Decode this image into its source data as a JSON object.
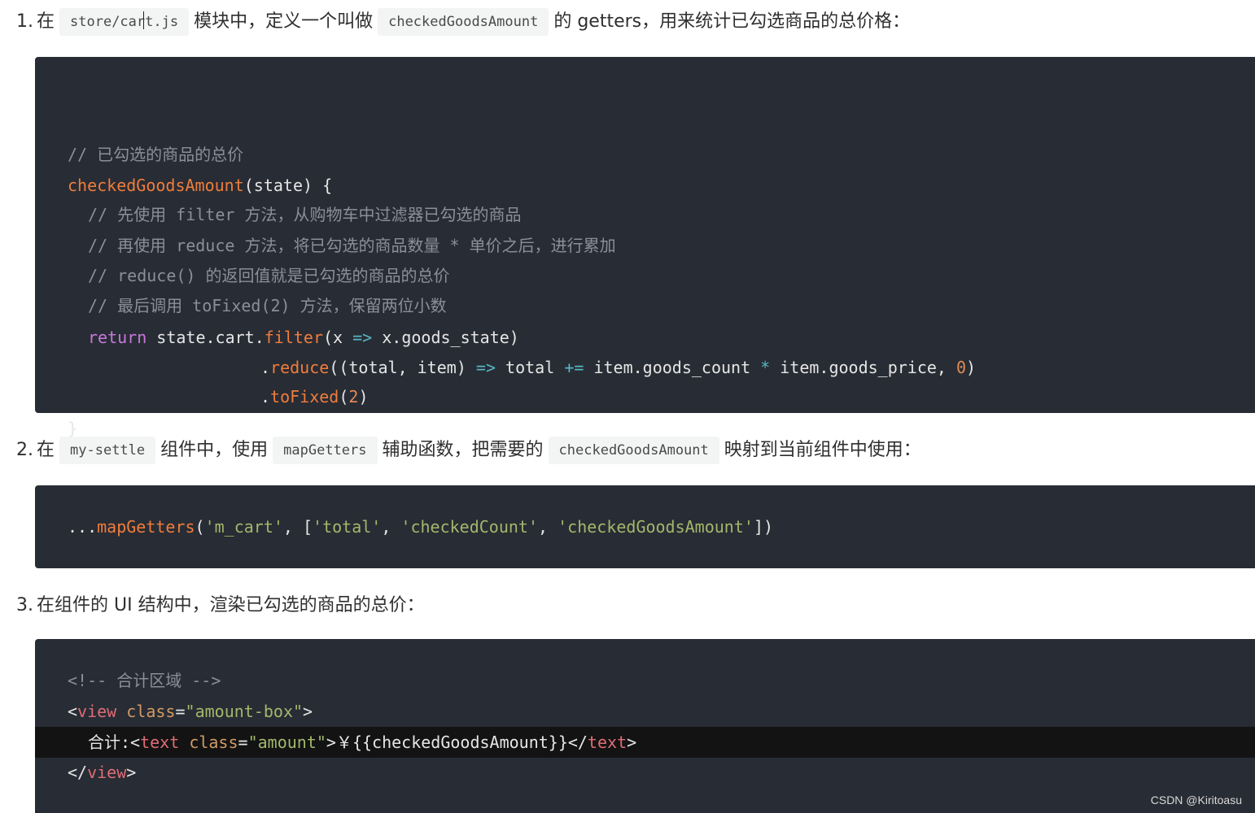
{
  "step1": {
    "num": "1.",
    "t1": "在",
    "code1": "store/cart.js",
    "t2": "模块中，定义一个叫做",
    "code2": "checkedGoodsAmount",
    "t3": "的 getters，用来统计已勾选商品的总价格："
  },
  "block1": {
    "l1": "// 已勾选的商品的总价",
    "l2_fn": "checkedGoodsAmount",
    "l2_rest": "(state) {",
    "l3": "// 先使用 filter 方法，从购物车中过滤器已勾选的商品",
    "l4": "// 再使用 reduce 方法，将已勾选的商品数量 * 单价之后，进行累加",
    "l5": "// reduce() 的返回值就是已勾选的商品的总价",
    "l6": "// 最后调用 toFixed(2) 方法，保留两位小数",
    "l7_kw": "return",
    "l7_a": " state.cart.",
    "l7_fn": "filter",
    "l7_b": "(x ",
    "l7_arrow": "=>",
    "l7_c": " x.goods_state)",
    "l8_dot": ".",
    "l8_fn": "reduce",
    "l8_a": "((total, item) ",
    "l8_arrow": "=>",
    "l8_b": " total ",
    "l8_op1": "+=",
    "l8_c": " item.goods_count ",
    "l8_op2": "*",
    "l8_d": " item.goods_price, ",
    "l8_num": "0",
    "l8_e": ")",
    "l9_dot": ".",
    "l9_fn": "toFixed",
    "l9_a": "(",
    "l9_num": "2",
    "l9_b": ")",
    "l10": "}"
  },
  "step2": {
    "num": "2.",
    "t1": "在",
    "code1": "my-settle",
    "t2": "组件中，使用",
    "code2": "mapGetters",
    "t3": "辅助函数，把需要的",
    "code3": "checkedGoodsAmount",
    "t4": "映射到当前组件中使用："
  },
  "block2": {
    "a": "...",
    "fn": "mapGetters",
    "b": "(",
    "s1": "'m_cart'",
    "c": ", [",
    "s2": "'total'",
    "d": ", ",
    "s3": "'checkedCount'",
    "e": ", ",
    "s4": "'checkedGoodsAmount'",
    "f": "])"
  },
  "step3": {
    "num": "3.",
    "t1": "在组件的 UI 结构中，渲染已勾选的商品的总价："
  },
  "block3": {
    "l1": "<!-- 合计区域 -->",
    "l2_a": "<",
    "l2_tag": "view",
    "l2_sp": " ",
    "l2_attr": "class",
    "l2_eq": "=",
    "l2_val": "\"amount-box\"",
    "l2_b": ">",
    "l3_text": "合计:",
    "l3_a": "<",
    "l3_tag": "text",
    "l3_sp": " ",
    "l3_attr": "class",
    "l3_eq": "=",
    "l3_val": "\"amount\"",
    "l3_b": ">",
    "l3_content": "￥{{checkedGoodsAmount}}",
    "l3_c": "</",
    "l3_tag2": "text",
    "l3_d": ">",
    "l4_a": "</",
    "l4_tag": "view",
    "l4_b": ">"
  },
  "watermark": "CSDN @Kiritoasu"
}
